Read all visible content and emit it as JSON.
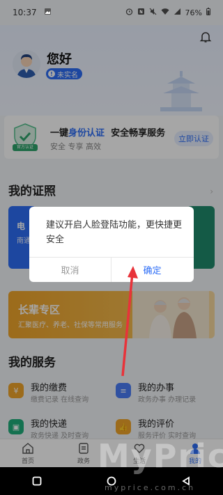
{
  "status_bar": {
    "time": "10:37",
    "battery": "76%"
  },
  "header": {
    "greeting": "您好",
    "badge": "未实名"
  },
  "auth_card": {
    "title_prefix": "一键",
    "title_highlight": "身份认证",
    "title_suffix": "安全畅享服务",
    "subtitle": "安全 专享 高效",
    "shield_label": "官方认证",
    "button": "立即认证"
  },
  "my_certs": {
    "title": "我的证照",
    "blue_card_title": "电",
    "blue_card_sub": "南通"
  },
  "elder": {
    "title": "长辈专区",
    "subtitle": "汇聚医疗、养老、社保等常用服务"
  },
  "services": {
    "title": "我的服务",
    "items": [
      {
        "title": "我的缴费",
        "sub": "缴费记录 在线查询",
        "color": "#f0a52a"
      },
      {
        "title": "我的办事",
        "sub": "政务办事 办理记录",
        "color": "#4a7df7"
      },
      {
        "title": "我的快递",
        "sub": "政务快递 及时查询",
        "color": "#1fae7b"
      },
      {
        "title": "我的评价",
        "sub": "服务评价 实时查询",
        "color": "#f0a52a"
      }
    ]
  },
  "tabs": [
    {
      "label": "首页",
      "icon": "home-icon"
    },
    {
      "label": "政务",
      "icon": "document-icon"
    },
    {
      "label": "生活",
      "icon": "heart-icon"
    },
    {
      "label": "我的",
      "icon": "user-icon"
    }
  ],
  "dialog": {
    "message": "建议开启人脸登陆功能，更快捷更安全",
    "cancel": "取消",
    "confirm": "确定"
  },
  "watermark": {
    "text": "MyPrice",
    "url": "myprice.com.cn"
  },
  "colors": {
    "accent": "#2d6df6",
    "arrow": "#e8333a"
  }
}
